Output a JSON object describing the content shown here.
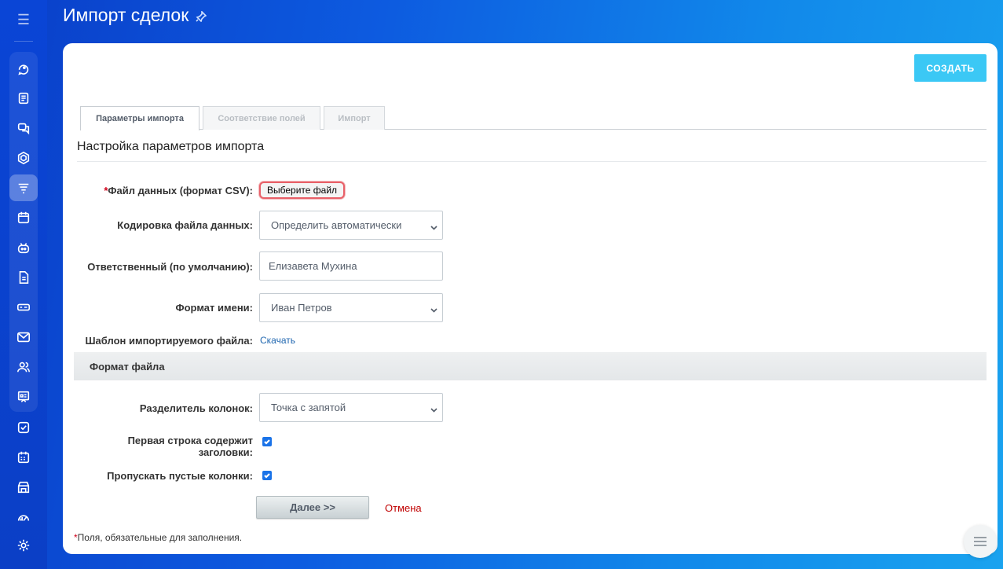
{
  "page": {
    "title": "Импорт сделок"
  },
  "toolbar": {
    "create_label": "СОЗДАТЬ"
  },
  "tabs": [
    {
      "label": "Параметры импорта",
      "active": true
    },
    {
      "label": "Соответствие полей",
      "active": false
    },
    {
      "label": "Импорт",
      "active": false
    }
  ],
  "section": {
    "title": "Настройка параметров импорта"
  },
  "fields": {
    "required_mark": "*",
    "data_file_label": "Файл данных (формат CSV):",
    "data_file_button": "Выберите файл",
    "encoding_label": "Кодировка файла данных:",
    "encoding_value": "Определить автоматически",
    "responsible_label": "Ответственный (по умолчанию):",
    "responsible_value": "Елизавета Мухина",
    "name_format_label": "Формат имени:",
    "name_format_value": "Иван Петров",
    "template_label": "Шаблон импортируемого файла:",
    "template_link": "Скачать"
  },
  "file_format": {
    "title": "Формат файла",
    "separator_label": "Разделитель колонок:",
    "separator_value": "Точка с запятой",
    "first_row_label_1": "Первая строка содержит",
    "first_row_label_2": "заголовки:",
    "first_row_checked": true,
    "skip_empty_label": "Пропускать пустые колонки:",
    "skip_empty_checked": true
  },
  "actions": {
    "next_label": "Далее >>",
    "cancel_label": "Отмена"
  },
  "footer": {
    "required_mark": "*",
    "note": "Поля, обязательные для заполнения."
  },
  "colors": {
    "accent": "#3bc8f5",
    "link": "#2067b0",
    "cancel": "#c00000",
    "required": "#d0021b",
    "checkbox": "#1a73e8"
  }
}
